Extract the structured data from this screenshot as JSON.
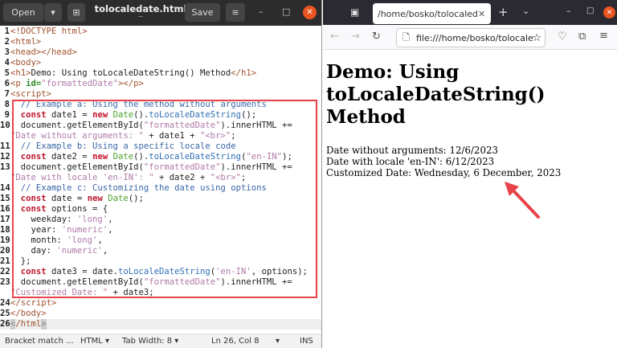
{
  "editor": {
    "open": "Open",
    "save": "Save",
    "title": "tolocaledate.html",
    "subtitle": "~",
    "lines": [
      {
        "n": "1",
        "t": [
          [
            "<!DOCTYPE html>",
            "tag"
          ]
        ]
      },
      {
        "n": "2",
        "t": [
          [
            "<html>",
            "tag"
          ]
        ]
      },
      {
        "n": "3",
        "t": [
          [
            "<head></head>",
            "tag"
          ]
        ]
      },
      {
        "n": "4",
        "t": [
          [
            "<body>",
            "tag"
          ]
        ]
      },
      {
        "n": "5",
        "t": [
          [
            "<h1>",
            "tag"
          ],
          [
            "Demo: Using toLocaleDateString() Method",
            "tx"
          ],
          [
            "</h1>",
            "tag"
          ]
        ]
      },
      {
        "n": "6",
        "t": [
          [
            "<p ",
            "tag"
          ],
          [
            "id=",
            "attr"
          ],
          [
            "\"formattedDate\"",
            "str"
          ],
          [
            "></p>",
            "tag"
          ]
        ]
      },
      {
        "n": "7",
        "t": [
          [
            "<script>",
            "tag"
          ]
        ]
      },
      {
        "n": "8",
        "t": [
          [
            "  // Example a: Using the method without arguments",
            "cm"
          ]
        ]
      },
      {
        "n": "9",
        "t": [
          [
            "  ",
            "tx"
          ],
          [
            "const",
            "kw"
          ],
          [
            " date1 = ",
            "tx"
          ],
          [
            "new",
            "kw"
          ],
          [
            " ",
            "tx"
          ],
          [
            "Date",
            "cls"
          ],
          [
            "().",
            "tx"
          ],
          [
            "toLocaleDateString",
            "fn"
          ],
          [
            "();",
            "tx"
          ]
        ]
      },
      {
        "n": "10",
        "t": [
          [
            "  document.getElementById(",
            "tx"
          ],
          [
            "\"formattedDate\"",
            "str"
          ],
          [
            ").innerHTML +=",
            "tx"
          ]
        ]
      },
      {
        "n": "",
        "t": [
          [
            "\"Date without arguments: \"",
            "str"
          ],
          [
            " + date1 + ",
            "tx"
          ],
          [
            "\"<br>\"",
            "str"
          ],
          [
            ";",
            "tx"
          ]
        ]
      },
      {
        "n": "11",
        "t": [
          [
            "  // Example b: Using a specific locale code",
            "cm"
          ]
        ]
      },
      {
        "n": "12",
        "t": [
          [
            "  ",
            "tx"
          ],
          [
            "const",
            "kw"
          ],
          [
            " date2 = ",
            "tx"
          ],
          [
            "new",
            "kw"
          ],
          [
            " ",
            "tx"
          ],
          [
            "Date",
            "cls"
          ],
          [
            "().",
            "tx"
          ],
          [
            "toLocaleDateString",
            "fn"
          ],
          [
            "(",
            "tx"
          ],
          [
            "\"en-IN\"",
            "str"
          ],
          [
            ");",
            "tx"
          ]
        ]
      },
      {
        "n": "13",
        "t": [
          [
            "  document.getElementById(",
            "tx"
          ],
          [
            "\"formattedDate\"",
            "str"
          ],
          [
            ").innerHTML +=",
            "tx"
          ]
        ]
      },
      {
        "n": "",
        "t": [
          [
            "\"Date with locale 'en-IN': \"",
            "str"
          ],
          [
            " + date2 + ",
            "tx"
          ],
          [
            "\"<br>\"",
            "str"
          ],
          [
            ";",
            "tx"
          ]
        ]
      },
      {
        "n": "14",
        "t": [
          [
            "  // Example c: Customizing the date using options",
            "cm"
          ]
        ]
      },
      {
        "n": "15",
        "t": [
          [
            "  ",
            "tx"
          ],
          [
            "const",
            "kw"
          ],
          [
            " date = ",
            "tx"
          ],
          [
            "new",
            "kw"
          ],
          [
            " ",
            "tx"
          ],
          [
            "Date",
            "cls"
          ],
          [
            "();",
            "tx"
          ]
        ]
      },
      {
        "n": "16",
        "t": [
          [
            "  ",
            "tx"
          ],
          [
            "const",
            "kw"
          ],
          [
            " options = {",
            "tx"
          ]
        ]
      },
      {
        "n": "17",
        "t": [
          [
            "    weekday: ",
            "tx"
          ],
          [
            "'long'",
            "str"
          ],
          [
            ",",
            "tx"
          ]
        ]
      },
      {
        "n": "18",
        "t": [
          [
            "    year: ",
            "tx"
          ],
          [
            "'numeric'",
            "str"
          ],
          [
            ",",
            "tx"
          ]
        ]
      },
      {
        "n": "19",
        "t": [
          [
            "    month: ",
            "tx"
          ],
          [
            "'long'",
            "str"
          ],
          [
            ",",
            "tx"
          ]
        ]
      },
      {
        "n": "20",
        "t": [
          [
            "    day: ",
            "tx"
          ],
          [
            "'numeric'",
            "str"
          ],
          [
            ",",
            "tx"
          ]
        ]
      },
      {
        "n": "21",
        "t": [
          [
            "  };",
            "tx"
          ]
        ]
      },
      {
        "n": "22",
        "t": [
          [
            "  ",
            "tx"
          ],
          [
            "const",
            "kw"
          ],
          [
            " date3 = date.",
            "tx"
          ],
          [
            "toLocaleDateString",
            "fn"
          ],
          [
            "(",
            "tx"
          ],
          [
            "'en-IN'",
            "str"
          ],
          [
            ", options);",
            "tx"
          ]
        ]
      },
      {
        "n": "23",
        "t": [
          [
            "  document.getElementById(",
            "tx"
          ],
          [
            "\"formattedDate\"",
            "str"
          ],
          [
            ").innerHTML +=",
            "tx"
          ]
        ]
      },
      {
        "n": "",
        "t": [
          [
            "\"Customized Date: \"",
            "str"
          ],
          [
            " + date3;",
            "tx"
          ]
        ]
      },
      {
        "n": "24",
        "t": [
          [
            "</script>",
            "tag"
          ]
        ]
      },
      {
        "n": "25",
        "t": [
          [
            "</body>",
            "tag"
          ]
        ]
      },
      {
        "n": "26",
        "t": [
          [
            "<",
            "br"
          ],
          [
            "/html",
            "tag"
          ],
          [
            ">",
            "br"
          ]
        ],
        "current": true
      }
    ],
    "status": {
      "bracket": "Bracket match ...",
      "lang": "HTML ▾",
      "tab": "Tab Width: 8 ▾",
      "pos": "Ln 26, Col 8",
      "arrow": "▾",
      "mode": "INS"
    }
  },
  "browser": {
    "tab": "/home/bosko/tolocaledat",
    "url": "file:///home/bosko/tolocale",
    "heading": "Demo: Using toLocaleDateString() Method",
    "out": [
      "Date without arguments: 12/6/2023",
      "Date with locale 'en-IN': 6/12/2023",
      "Customized Date: Wednesday, 6 December, 2023"
    ]
  },
  "colors": {
    "highlight": "#e8434a",
    "close": "#e95420"
  }
}
